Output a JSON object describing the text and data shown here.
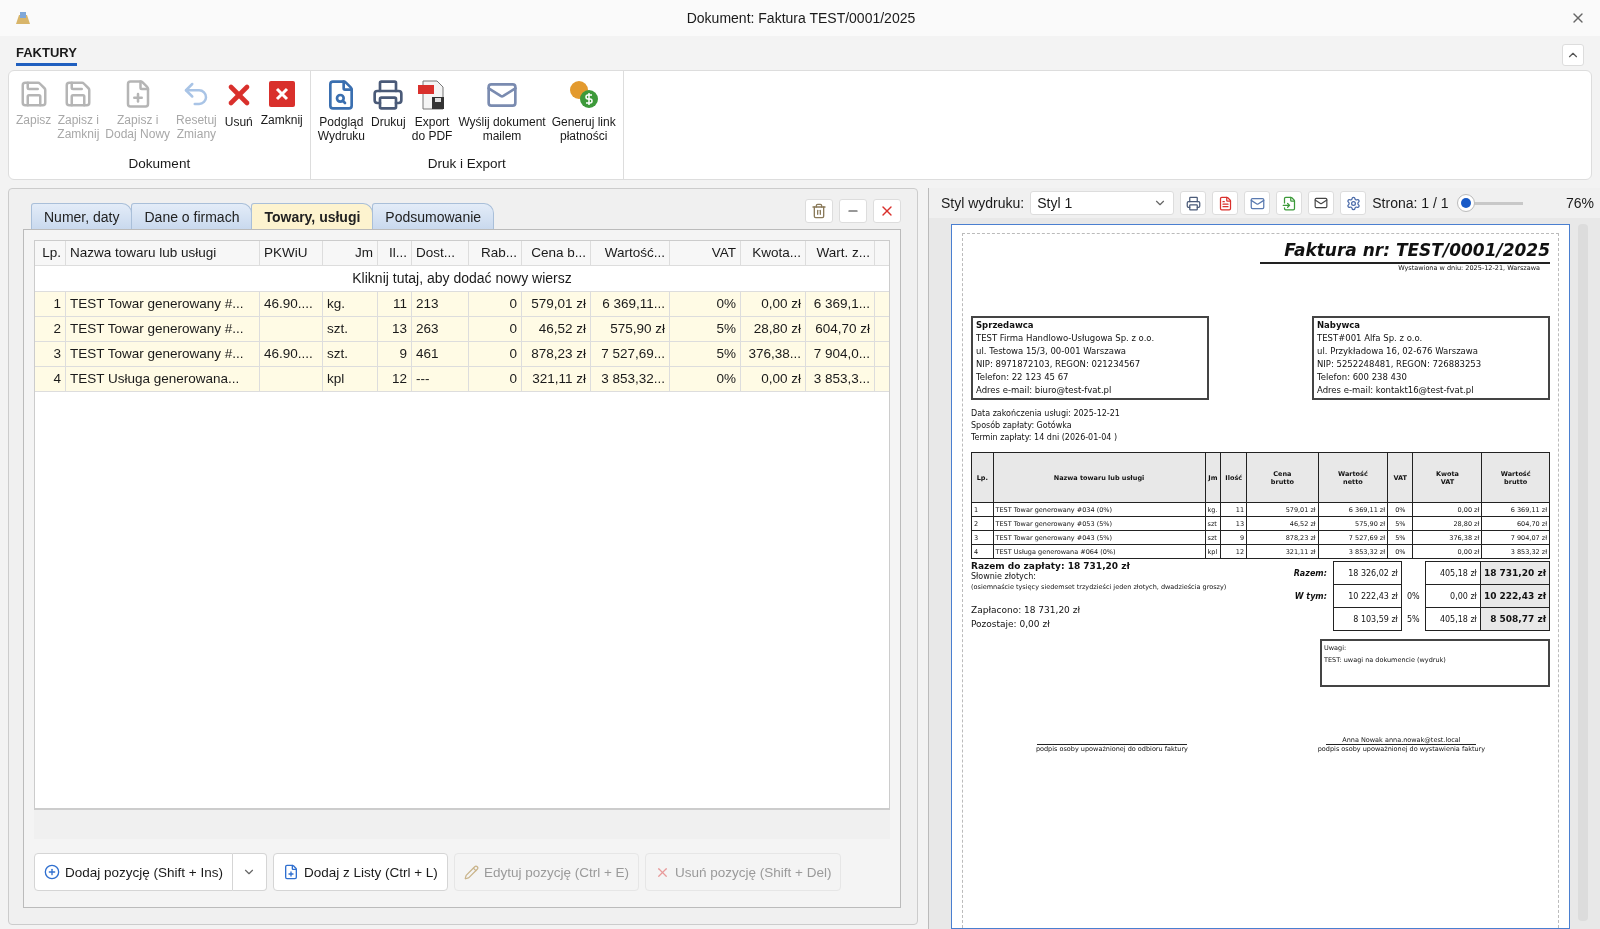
{
  "window": {
    "title": "Dokument: Faktura TEST/0001/2025"
  },
  "ribbon": {
    "tab": "FAKTURY",
    "groups": [
      {
        "label": "Dokument",
        "buttons": [
          {
            "label": "Zapisz",
            "disabled": true
          },
          {
            "label": "Zapisz i\nZamknij",
            "disabled": true
          },
          {
            "label": "Zapisz i\nDodaj Nowy",
            "disabled": true
          },
          {
            "label": "Resetuj\nZmiany",
            "disabled": true
          },
          {
            "label": "Usuń",
            "disabled": false
          },
          {
            "label": "Zamknij",
            "disabled": false
          }
        ]
      },
      {
        "label": "Druk i Export",
        "buttons": [
          {
            "label": "Podgląd\nWydruku",
            "disabled": false
          },
          {
            "label": "Drukuj",
            "disabled": false
          },
          {
            "label": "Export\ndo PDF",
            "disabled": false
          },
          {
            "label": "Wyślij dokument\nmailem",
            "disabled": false
          },
          {
            "label": "Generuj link\npłatności",
            "disabled": false
          }
        ]
      }
    ]
  },
  "editor": {
    "tabs": [
      {
        "label": "Numer, daty",
        "selected": false
      },
      {
        "label": "Dane o firmach",
        "selected": false
      },
      {
        "label": "Towary, usługi",
        "selected": true
      },
      {
        "label": "Podsumowanie",
        "selected": false
      }
    ],
    "table": {
      "columns": [
        "Lp.",
        "Nazwa towaru lub usługi",
        "PKWiU",
        "Jm",
        "Il...",
        "Dost...",
        "Rab...",
        "Cena b...",
        "Wartość...",
        "VAT",
        "Kwota...",
        "Wart. z..."
      ],
      "add_row_hint": "Kliknij tutaj, aby dodać nowy wiersz",
      "rows": [
        [
          "1",
          "TEST Towar generowany #...",
          "46.90....",
          "kg.",
          "11",
          "213",
          "0",
          "579,01 zł",
          "6 369,11...",
          "0%",
          "0,00 zł",
          "6 369,1..."
        ],
        [
          "2",
          "TEST Towar generowany #...",
          null,
          "szt.",
          "13",
          "263",
          "0",
          "46,52 zł",
          "575,90 zł",
          "5%",
          "28,80 zł",
          "604,70 zł"
        ],
        [
          "3",
          "TEST Towar generowany #...",
          "46.90....",
          "szt.",
          "9",
          "461",
          "0",
          "878,23 zł",
          "7 527,69...",
          "5%",
          "376,38...",
          "7 904,0..."
        ],
        [
          "4",
          "TEST Usługa generowana...",
          null,
          "kpl",
          "12",
          "---",
          "0",
          "321,11 zł",
          "3 853,32...",
          "0%",
          "0,00 zł",
          "3 853,3..."
        ]
      ]
    },
    "buttons": [
      {
        "label": "Dodaj pozycję (Shift + Ins)",
        "disabled": false,
        "menu": true
      },
      {
        "label": "Dodaj z Listy (Ctrl + L)",
        "disabled": false,
        "menu": false
      },
      {
        "label": "Edytuj pozycję (Ctrl + E)",
        "disabled": true,
        "menu": false
      },
      {
        "label": "Usuń pozycję (Shift + Del)",
        "disabled": true,
        "menu": false
      }
    ]
  },
  "preview": {
    "style_label": "Styl wydruku:",
    "style_value": "Styl 1",
    "page_label": "Strona: 1 / 1",
    "zoom": {
      "level": 0.12,
      "reading": "76%"
    },
    "document": {
      "title": "Faktura nr: TEST/0001/2025",
      "issued": "Wystawiona w dniu: 2025-12-21, Warszawa",
      "parties": [
        {
          "heading": "Sprzedawca",
          "lines": [
            "TEST Firma Handlowo-Usługowa Sp. z o.o.",
            "ul. Testowa 15/3, 00-001 Warszawa",
            "NIP: 8971872103, REGON: 021234567",
            "Telefon: 22 123 45 67",
            "Adres e-mail: biuro@test-fvat.pl"
          ]
        },
        {
          "heading": "Nabywca",
          "lines": [
            "TEST#001 Alfa Sp. z o.o.",
            "ul. Przykładowa 16, 02-676 Warszawa",
            "NIP: 5252248481, REGON: 726883253",
            "Telefon: 600 238 430",
            "Adres e-mail: kontakt16@test-fvat.pl"
          ]
        }
      ],
      "details": [
        "Data zakończenia usługi: 2025-12-21",
        "Sposób zapłaty: Gotówka",
        "Termin zapłaty: 14 dni (2026-01-04 )"
      ],
      "columns": [
        "Lp.",
        "Nazwa towaru lub usługi",
        "Jm",
        "Ilość",
        "Cena\nbrutto",
        "Wartość\nnetto",
        "VAT",
        "Kwota\nVAT",
        "Wartość\nbrutto"
      ],
      "rows": [
        [
          "1",
          "TEST Towar generowany #034 (0%)",
          "kg.",
          "11",
          "579,01 zł",
          "6 369,11 zł",
          "0%",
          "0,00 zł",
          "6 369,11 zł"
        ],
        [
          "2",
          "TEST Towar generowany #053 (5%)",
          "szt",
          "13",
          "46,52 zł",
          "575,90 zł",
          "5%",
          "28,80 zł",
          "604,70 zł"
        ],
        [
          "3",
          "TEST Towar generowany #043 (5%)",
          "szt",
          "9",
          "878,23 zł",
          "7 527,69 zł",
          "5%",
          "376,38 zł",
          "7 904,07 zł"
        ],
        [
          "4",
          "TEST Usługa generowana #064 (0%)",
          "kpl",
          "12",
          "321,11 zł",
          "3 853,32 zł",
          "0%",
          "0,00 zł",
          "3 853,32 zł"
        ]
      ],
      "total": "Razem do zapłaty: 18 731,20 zł",
      "words_label": "Słownie złotych:",
      "words": "(osiemnaście tysięcy siedemset trzydzieści jeden złotych, dwadzieścia groszy)",
      "paid": "Zapłacono: 18 731,20 zł",
      "remaining": "Pozostaje: 0,00 zł",
      "summary": [
        {
          "label": "Razem:",
          "net": "18 326,02 zł",
          "vat": "405,18 zł",
          "gross": "18 731,20 zł"
        },
        {
          "label": "W tym:",
          "net": "10 222,43 zł",
          "rate": "0%",
          "vat": "0,00 zł",
          "gross": "10 222,43 zł"
        },
        {
          "net": "8 103,59 zł",
          "rate": "5%",
          "vat": "405,18 zł",
          "gross": "8 508,77 zł"
        }
      ],
      "notes": {
        "heading": "Uwagi:",
        "text": "TEST: uwagi na dokumencie (wydruk)"
      },
      "signatures": [
        {
          "caption": "podpis osoby upoważnionej do odbioru faktury"
        },
        {
          "name": "Anna Nowak anna.nowak@test.local",
          "caption": "podpis osoby upoważnionej do wystawienia faktury"
        }
      ]
    }
  }
}
